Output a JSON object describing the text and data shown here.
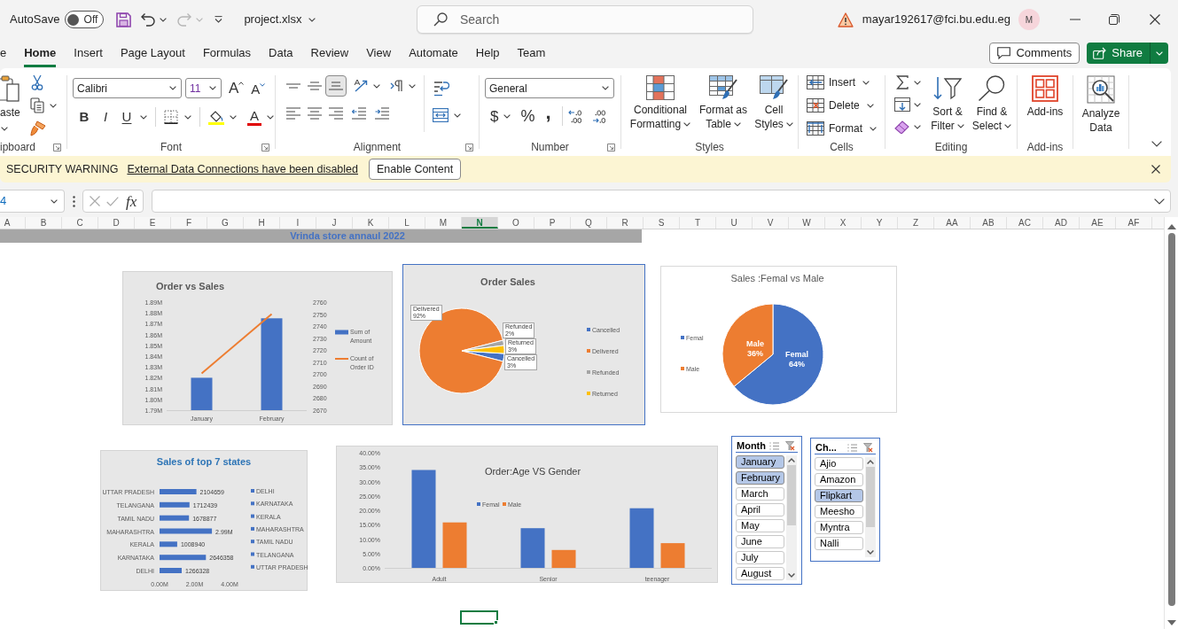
{
  "title_bar": {
    "autosave": {
      "label": "AutoSave",
      "state_label": "Off",
      "on": false
    },
    "file_name": "project.xlsx",
    "search": {
      "placeholder": "Search"
    },
    "account": "mayar192617@fci.bu.edu.eg",
    "avatar": "M"
  },
  "ribbon_tabs": [
    {
      "label": "e",
      "selected": false
    },
    {
      "label": "Home",
      "selected": true
    },
    {
      "label": "Insert",
      "selected": false
    },
    {
      "label": "Page Layout",
      "selected": false
    },
    {
      "label": "Formulas",
      "selected": false
    },
    {
      "label": "Data",
      "selected": false
    },
    {
      "label": "Review",
      "selected": false
    },
    {
      "label": "View",
      "selected": false
    },
    {
      "label": "Automate",
      "selected": false
    },
    {
      "label": "Help",
      "selected": false
    },
    {
      "label": "Team",
      "selected": false
    }
  ],
  "header_buttons": {
    "comments": "Comments",
    "share": "Share"
  },
  "ribbon": {
    "clipboard": {
      "label": "ipboard",
      "paste": "aste"
    },
    "font": {
      "label": "Font",
      "font_name": "Calibri",
      "font_size": "11",
      "grow": "A",
      "shrink": "A",
      "bold": "B",
      "italic": "I",
      "underline": "U",
      "font_color": "A"
    },
    "alignment": {
      "label": "Alignment",
      "vertical_align": [
        {
          "selected": false
        },
        {
          "selected": false
        },
        {
          "selected": true
        }
      ]
    },
    "number": {
      "label": "Number",
      "format": "General",
      "currency": "$",
      "percent": "%",
      "comma": ","
    },
    "styles": {
      "label": "Styles",
      "buttons": [
        {
          "label": "Conditional Formatting",
          "dropdown": true
        },
        {
          "label": "Format as Table",
          "dropdown": true
        },
        {
          "label": "Cell Styles",
          "dropdown": true
        }
      ]
    },
    "cells": {
      "label": "Cells",
      "buttons": [
        {
          "label": "Insert",
          "dropdown": true
        },
        {
          "label": "Delete",
          "dropdown": true
        },
        {
          "label": "Format",
          "dropdown": true
        }
      ]
    },
    "editing": {
      "label": "Editing",
      "buttons": [
        {
          "label": "Sort & Filter",
          "dropdown": true
        },
        {
          "label": "Find & Select",
          "dropdown": true
        }
      ]
    },
    "add_ins": {
      "label": "Add-ins",
      "buttons": [
        {
          "label": "Add-ins",
          "dropdown": false
        }
      ]
    },
    "analyze": {
      "buttons": [
        {
          "label": "Analyze Data",
          "dropdown": false
        }
      ]
    }
  },
  "message_bar": {
    "title": "SECURITY WARNING",
    "message": "External Data Connections have been disabled",
    "button": "Enable Content"
  },
  "formula_bar": {
    "name_box": "4",
    "function_label": "fx"
  },
  "columns": [
    {
      "label": "A",
      "selected": false
    },
    {
      "label": "B",
      "selected": false
    },
    {
      "label": "C",
      "selected": false
    },
    {
      "label": "D",
      "selected": false
    },
    {
      "label": "E",
      "selected": false
    },
    {
      "label": "F",
      "selected": false
    },
    {
      "label": "G",
      "selected": false
    },
    {
      "label": "H",
      "selected": false
    },
    {
      "label": "I",
      "selected": false
    },
    {
      "label": "J",
      "selected": false
    },
    {
      "label": "K",
      "selected": false
    },
    {
      "label": "L",
      "selected": false
    },
    {
      "label": "M",
      "selected": false
    },
    {
      "label": "N",
      "selected": true
    },
    {
      "label": "O",
      "selected": false
    },
    {
      "label": "P",
      "selected": false
    },
    {
      "label": "Q",
      "selected": false
    },
    {
      "label": "R",
      "selected": false
    },
    {
      "label": "S",
      "selected": false
    },
    {
      "label": "T",
      "selected": false
    },
    {
      "label": "U",
      "selected": false
    },
    {
      "label": "V",
      "selected": false
    },
    {
      "label": "W",
      "selected": false
    },
    {
      "label": "X",
      "selected": false
    },
    {
      "label": "Y",
      "selected": false
    },
    {
      "label": "Z",
      "selected": false
    },
    {
      "label": "AA",
      "selected": false
    },
    {
      "label": "AB",
      "selected": false
    },
    {
      "label": "AC",
      "selected": false
    },
    {
      "label": "AD",
      "selected": false
    },
    {
      "label": "AE",
      "selected": false
    },
    {
      "label": "AF",
      "selected": false
    }
  ],
  "sheet": {
    "banner": "Vrinda store annaul 2022",
    "charts": [
      {
        "chart_data": {
          "type": "bar",
          "title": "Order vs Sales",
          "categories": [
            "January",
            "February"
          ],
          "series": [
            {
              "name": "Sum of Amount",
              "color": "#4472c4",
              "values": [
                1820000,
                1875000
              ]
            },
            {
              "name": "Count of Order ID",
              "type": "line",
              "color": "#ed7d31",
              "values": [
                1824000,
                1879000
              ]
            }
          ],
          "ylim": [
            1790000,
            1890000
          ],
          "yticks": [
            {
              "value": 1790000,
              "label": "1.79M"
            },
            {
              "value": 1800000,
              "label": "1.80M"
            },
            {
              "value": 1810000,
              "label": "1.81M"
            },
            {
              "value": 1820000,
              "label": "1.82M"
            },
            {
              "value": 1830000,
              "label": "1.83M"
            },
            {
              "value": 1840000,
              "label": "1.84M"
            },
            {
              "value": 1850000,
              "label": "1.85M"
            },
            {
              "value": 1860000,
              "label": "1.86M"
            },
            {
              "value": 1870000,
              "label": "1.87M"
            },
            {
              "value": 1880000,
              "label": "1.88M"
            },
            {
              "value": 1890000,
              "label": "1.89M"
            }
          ],
          "y2lim": [
            2670,
            2760
          ],
          "y2ticks": [
            {
              "value": 2670,
              "label": "2670"
            },
            {
              "value": 2680,
              "label": "2680"
            },
            {
              "value": 2690,
              "label": "2690"
            },
            {
              "value": 2700,
              "label": "2700"
            },
            {
              "value": 2710,
              "label": "2710"
            },
            {
              "value": 2720,
              "label": "2720"
            },
            {
              "value": 2730,
              "label": "2730"
            },
            {
              "value": 2740,
              "label": "2740"
            },
            {
              "value": 2750,
              "label": "2750"
            },
            {
              "value": 2760,
              "label": "2760"
            }
          ],
          "legend": true
        }
      },
      {
        "chart_data": {
          "type": "pie",
          "title": "Order Sales",
          "categories": [
            "Cancelled",
            "Delivered",
            "Refunded",
            "Returned"
          ],
          "values": [
            3,
            92,
            2,
            3
          ],
          "colors": [
            "#4472c4",
            "#ed7d31",
            "#a5a5a5",
            "#ffc000"
          ],
          "value_labels": [
            "3%",
            "92%",
            "2%",
            "3%"
          ],
          "legend": true
        }
      },
      {
        "chart_data": {
          "type": "pie",
          "title": "Sales :Femal vs Male",
          "categories": [
            "Femal",
            "Male"
          ],
          "values": [
            64,
            36
          ],
          "colors": [
            "#4472c4",
            "#ed7d31"
          ],
          "value_labels": [
            "64%",
            "36%"
          ],
          "legend": true
        }
      },
      {
        "chart_data": {
          "type": "bar",
          "orientation": "horizontal",
          "title": "Sales of top 7 states",
          "categories": [
            "UTTAR PRADESH",
            "TELANGANA",
            "TAMIL NADU",
            "MAHARASHTRA",
            "KERALA",
            "KARNATAKA",
            "DELHI"
          ],
          "series": [
            {
              "color": "#4472c4",
              "values": [
                2104659,
                1712439,
                1678877,
                2990000,
                1008940,
                2646358,
                1266328
              ]
            }
          ],
          "value_labels": [
            "2104659",
            "1712439",
            "1678877",
            "2.99M",
            "1008940",
            "2646358",
            "1266328"
          ],
          "xlim": [
            0,
            4000000
          ],
          "xticks": [
            {
              "value": 0,
              "label": "0.00M"
            },
            {
              "value": 2000000,
              "label": "2.00M"
            },
            {
              "value": 4000000,
              "label": "4.00M"
            }
          ]
        },
        "legend_entries": [
          "DELHI",
          "KARNATAKA",
          "KERALA",
          "MAHARASHTRA",
          "TAMIL NADU",
          "TELANGANA",
          "UTTAR PRADESH"
        ]
      },
      {
        "chart_data": {
          "type": "bar",
          "title": "Order:Age VS Gender",
          "categories": [
            "Adult",
            "Senior",
            "teenager"
          ],
          "series": [
            {
              "name": "Femal",
              "color": "#4472c4",
              "values": [
                0.34,
                0.138,
                0.207
              ]
            },
            {
              "name": "Male",
              "color": "#ed7d31",
              "values": [
                0.158,
                0.062,
                0.086
              ]
            }
          ],
          "ylim": [
            0,
            0.4
          ],
          "yticks": [
            {
              "value": 0,
              "label": "0.00%"
            },
            {
              "value": 0.05,
              "label": "5.00%"
            },
            {
              "value": 0.1,
              "label": "10.00%"
            },
            {
              "value": 0.15,
              "label": "15.00%"
            },
            {
              "value": 0.2,
              "label": "20.00%"
            },
            {
              "value": 0.25,
              "label": "25.00%"
            },
            {
              "value": 0.3,
              "label": "30.00%"
            },
            {
              "value": 0.35,
              "label": "35.00%"
            },
            {
              "value": 0.4,
              "label": "40.00%"
            }
          ],
          "legend": true
        }
      }
    ],
    "slicers": [
      {
        "title": "Month",
        "items": [
          {
            "label": "January",
            "selected": true
          },
          {
            "label": "February",
            "selected": true
          },
          {
            "label": "March",
            "selected": false
          },
          {
            "label": "April",
            "selected": false
          },
          {
            "label": "May",
            "selected": false
          },
          {
            "label": "June",
            "selected": false
          },
          {
            "label": "July",
            "selected": false
          },
          {
            "label": "August",
            "selected": false
          }
        ]
      },
      {
        "title": "Ch...",
        "items": [
          {
            "label": "Ajio",
            "selected": false
          },
          {
            "label": "Amazon",
            "selected": false
          },
          {
            "label": "Flipkart",
            "selected": true
          },
          {
            "label": "Meesho",
            "selected": false
          },
          {
            "label": "Myntra",
            "selected": false
          },
          {
            "label": "Nalli",
            "selected": false
          }
        ]
      }
    ]
  }
}
